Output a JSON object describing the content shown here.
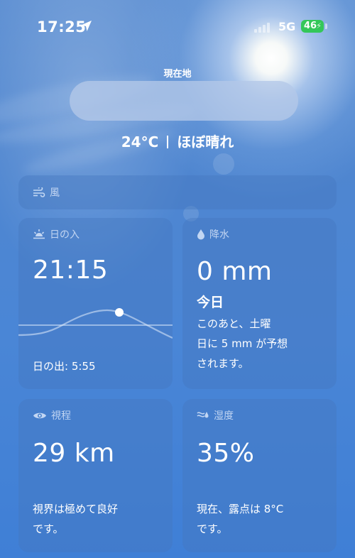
{
  "status_bar": {
    "time": "17:25",
    "network": "5G",
    "battery": "46"
  },
  "location": {
    "label": "現在地"
  },
  "weather_summary": {
    "temperature": "24°C",
    "condition": "ほぼ晴れ"
  },
  "wind_card": {
    "title": "風"
  },
  "sunset_card": {
    "title": "日の入",
    "value": "21:15",
    "sunrise": "日の出: 5:55"
  },
  "precip_card": {
    "title": "降水",
    "value": "0 mm",
    "period": "今日",
    "line1": "このあと、土曜",
    "line2": "日に 5 mm が予想",
    "line3": "されます。"
  },
  "visibility_card": {
    "title": "視程",
    "value": "29 km",
    "line1": "視界は極めて良好",
    "line2": "です。"
  },
  "humidity_card": {
    "title": "湿度",
    "value": "35%",
    "line1": "現在、露点は 8°C",
    "line2": "です。"
  },
  "colors": {
    "card_label": "#e1ecfc",
    "battery_green": "#34c759"
  },
  "icons": {
    "wind": "wind-icon",
    "sunset": "sunset-icon",
    "precip": "raindrop-icon",
    "visibility": "eye-icon",
    "humidity": "humidity-icon",
    "location": "location-arrow-icon"
  }
}
